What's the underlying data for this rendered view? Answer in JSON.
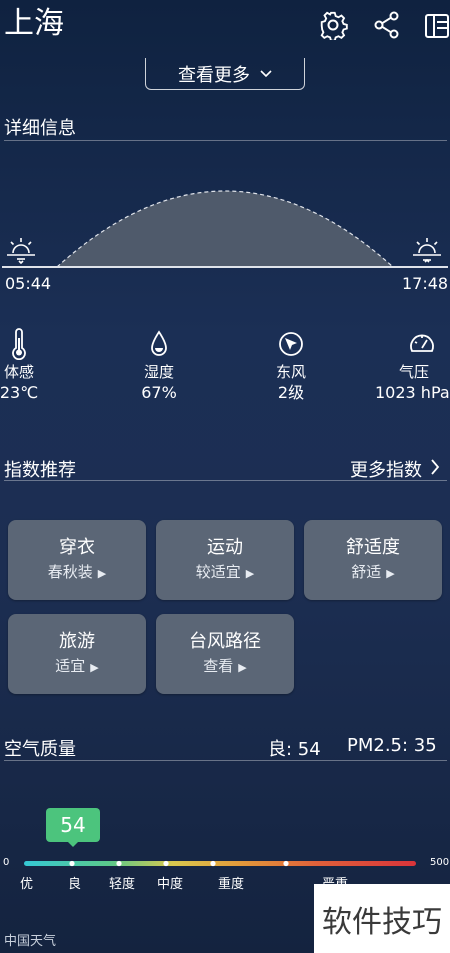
{
  "header": {
    "city": "上海"
  },
  "view_more": {
    "label": "查看更多"
  },
  "details": {
    "title": "详细信息",
    "sunrise": "05:44",
    "sunset": "17:48",
    "metrics": [
      {
        "icon": "thermometer-icon",
        "label": "体感",
        "value": "23℃"
      },
      {
        "icon": "humidity-drop-icon",
        "label": "湿度",
        "value": "67%"
      },
      {
        "icon": "wind-direction-icon",
        "label": "东风",
        "value": "2级"
      },
      {
        "icon": "pressure-gauge-icon",
        "label": "气压",
        "value": "1023 hPa"
      }
    ]
  },
  "indices": {
    "title": "指数推荐",
    "more": "更多指数",
    "cards": [
      {
        "title": "穿衣",
        "sub": "春秋装"
      },
      {
        "title": "运动",
        "sub": "较适宜"
      },
      {
        "title": "舒适度",
        "sub": "舒适"
      },
      {
        "title": "旅游",
        "sub": "适宜"
      },
      {
        "title": "台风路径",
        "sub": "查看"
      }
    ]
  },
  "air": {
    "title": "空气质量",
    "level_text": "良: 54",
    "pm25_text": "PM2.5: 35",
    "value": "54",
    "scale_min": "0",
    "scale_max": "500",
    "levels": [
      "优",
      "良",
      "轻度",
      "中度",
      "重度",
      "严重"
    ]
  },
  "footer": {
    "source": "中国天气"
  },
  "watermark": {
    "text": "软件技巧"
  }
}
